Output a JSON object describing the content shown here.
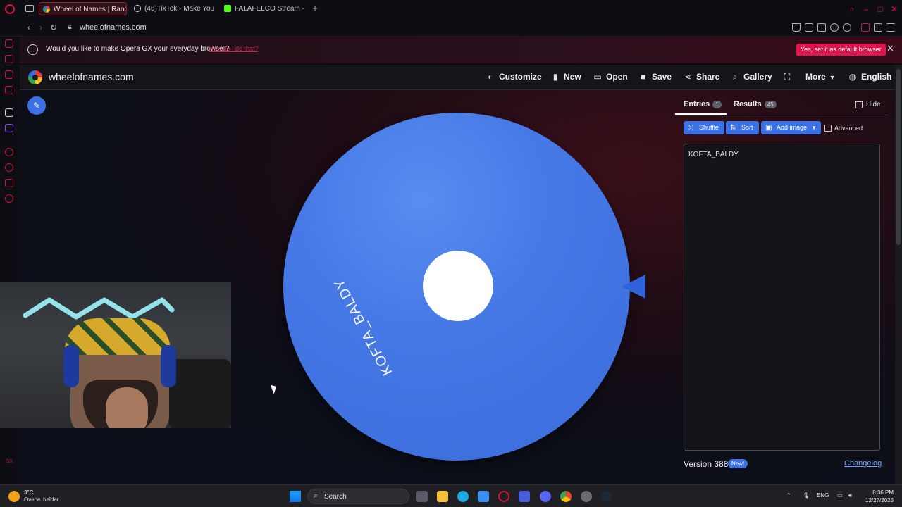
{
  "browser": {
    "tabs": [
      {
        "title": "Wheel of Names | Random",
        "active": true
      },
      {
        "title": "(46)TikTok - Make Your D",
        "active": false
      },
      {
        "title": "FALAFELCO Stream - Wat",
        "active": false
      }
    ],
    "url": "wheelofnames.com"
  },
  "notification": {
    "text": "Would you like to make Opera GX your everyday browser?",
    "link": "How do I do that?",
    "button": "Yes, set it as default browser"
  },
  "site": {
    "title": "wheelofnames.com",
    "nav": {
      "customize": "Customize",
      "new": "New",
      "open": "Open",
      "save": "Save",
      "share": "Share",
      "gallery": "Gallery",
      "more": "More",
      "language": "English"
    }
  },
  "wheel": {
    "label": "KOFTA_BALDY",
    "color": "#4678e6"
  },
  "panel": {
    "tabs": {
      "entries": "Entries",
      "entries_count": "1",
      "results": "Results",
      "results_count": "45"
    },
    "hide_label": "Hide",
    "buttons": {
      "shuffle": "Shuffle",
      "sort": "Sort",
      "add_image": "Add image"
    },
    "advanced_label": "Advanced",
    "entries_text": "KOFTA_BALDY",
    "version": "Version 388",
    "new_badge": "New!",
    "changelog": "Changelog"
  },
  "taskbar": {
    "weather_temp": "3°C",
    "weather_desc": "Overw. helder",
    "search": "Search",
    "lang": "ENG",
    "time": "8:36 PM",
    "date": "12/27/2025"
  }
}
